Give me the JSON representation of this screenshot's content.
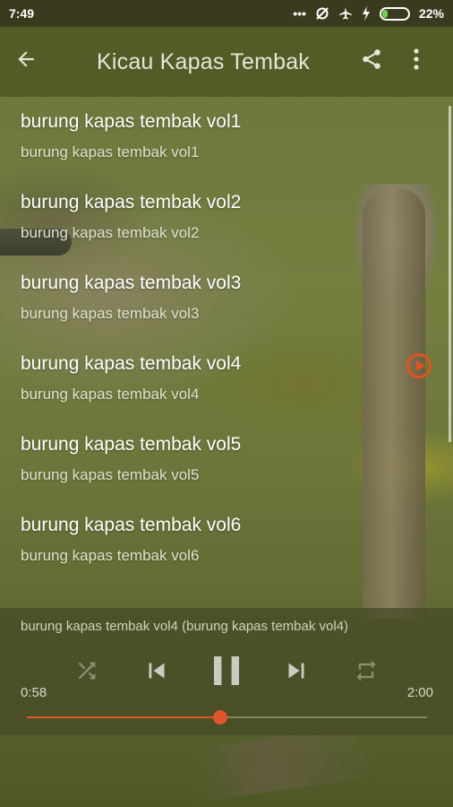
{
  "status_bar": {
    "time": "7:49",
    "icons": [
      "more-dots-icon",
      "data-saver-icon",
      "airplane-icon",
      "charging-icon"
    ],
    "battery_level": 0.22,
    "battery_text": "22%",
    "battery_color": "#6fd04e"
  },
  "app_bar": {
    "back_icon": "arrow-back-icon",
    "title": "Kicau Kapas Tembak",
    "share_icon": "share-icon",
    "menu_icon": "overflow-menu-icon"
  },
  "tracks": [
    {
      "title": "burung kapas tembak vol1",
      "subtitle": "burung kapas tembak vol1",
      "playing": false
    },
    {
      "title": "burung kapas tembak vol2",
      "subtitle": "burung kapas tembak vol2",
      "playing": false
    },
    {
      "title": "burung kapas tembak vol3",
      "subtitle": "burung kapas tembak vol3",
      "playing": false
    },
    {
      "title": "burung kapas tembak vol4",
      "subtitle": "burung kapas tembak vol4",
      "playing": true
    },
    {
      "title": "burung kapas tembak vol5",
      "subtitle": "burung kapas tembak vol5",
      "playing": false
    },
    {
      "title": "burung kapas tembak vol6",
      "subtitle": "burung kapas tembak vol6",
      "playing": false
    }
  ],
  "player": {
    "now_playing": "burung kapas tembak vol4 (burung kapas tembak vol4)",
    "elapsed": "0:58",
    "total": "2:00",
    "progress": 0.4833,
    "accent_color": "#e0562a",
    "controls": [
      "shuffle-icon",
      "skip-previous-icon",
      "pause-icon",
      "skip-next-icon",
      "repeat-icon"
    ]
  }
}
